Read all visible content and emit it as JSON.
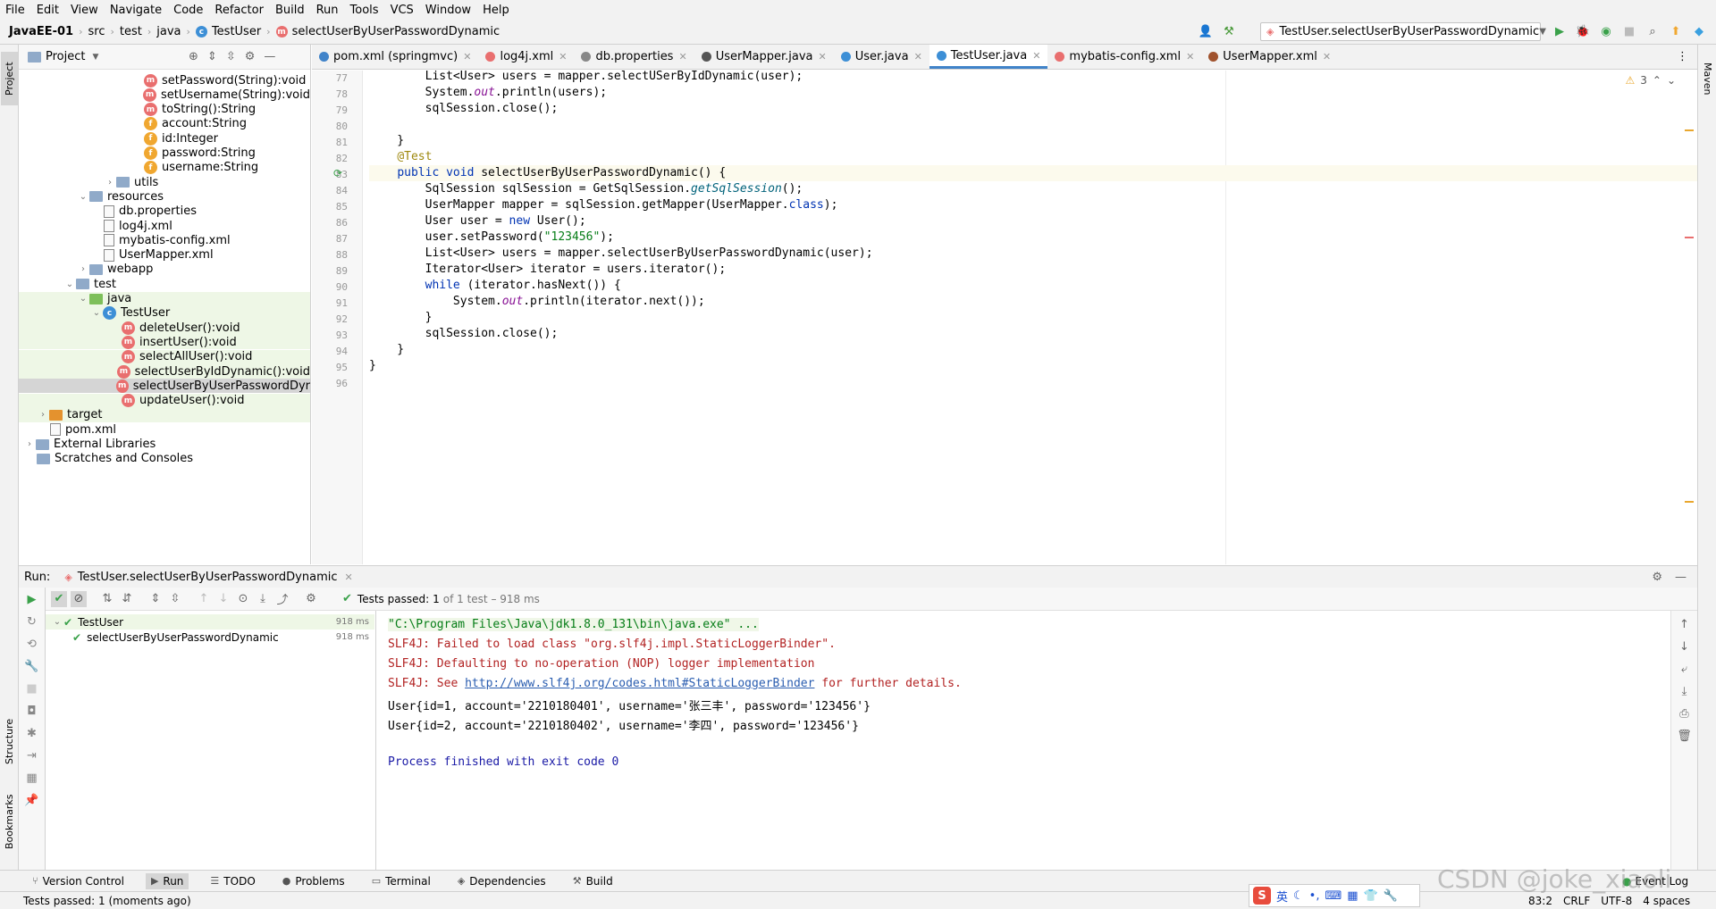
{
  "menu": [
    "File",
    "Edit",
    "View",
    "Navigate",
    "Code",
    "Refactor",
    "Build",
    "Run",
    "Tools",
    "VCS",
    "Window",
    "Help"
  ],
  "breadcrumb": [
    "JavaEE-01",
    "src",
    "test",
    "java",
    "TestUser",
    "selectUserByUserPasswordDynamic"
  ],
  "run_config": "TestUser.selectUserByUserPasswordDynamic",
  "project": {
    "title": "Project",
    "tree": [
      {
        "label": "setPassword(String):void",
        "icon": "m",
        "indent": 140
      },
      {
        "label": "setUsername(String):void",
        "icon": "m",
        "indent": 140
      },
      {
        "label": "toString():String",
        "icon": "m",
        "indent": 140
      },
      {
        "label": "account:String",
        "icon": "f",
        "indent": 140
      },
      {
        "label": "id:Integer",
        "icon": "f",
        "indent": 140
      },
      {
        "label": "password:String",
        "icon": "f",
        "indent": 140
      },
      {
        "label": "username:String",
        "icon": "f",
        "indent": 140
      },
      {
        "label": "utils",
        "icon": "folder",
        "indent": 95,
        "arrow": "›"
      },
      {
        "label": "resources",
        "icon": "folder",
        "indent": 65,
        "arrow": "⌄"
      },
      {
        "label": "db.properties",
        "icon": "file",
        "indent": 95
      },
      {
        "label": "log4j.xml",
        "icon": "file",
        "indent": 95
      },
      {
        "label": "mybatis-config.xml",
        "icon": "file",
        "indent": 95
      },
      {
        "label": "UserMapper.xml",
        "icon": "file",
        "indent": 95
      },
      {
        "label": "webapp",
        "icon": "folder",
        "indent": 65,
        "arrow": "›"
      },
      {
        "label": "test",
        "icon": "folder",
        "indent": 50,
        "arrow": "⌄"
      },
      {
        "label": "java",
        "icon": "folder-green",
        "indent": 65,
        "arrow": "⌄",
        "green": true
      },
      {
        "label": "TestUser",
        "icon": "c",
        "indent": 80,
        "arrow": "⌄",
        "green": true
      },
      {
        "label": "deleteUser():void",
        "icon": "m",
        "indent": 115,
        "green": true
      },
      {
        "label": "insertUser():void",
        "icon": "m",
        "indent": 115,
        "green": true
      },
      {
        "label": "selectAllUser():void",
        "icon": "m",
        "indent": 115,
        "green": true
      },
      {
        "label": "selectUserByIdDynamic():void",
        "icon": "m",
        "indent": 115,
        "green": true
      },
      {
        "label": "selectUserByUserPasswordDyr",
        "icon": "m",
        "indent": 115,
        "sel": true
      },
      {
        "label": "updateUser():void",
        "icon": "m",
        "indent": 115,
        "green": true
      },
      {
        "label": "target",
        "icon": "folder-orange",
        "indent": 20,
        "arrow": "›",
        "green": true
      },
      {
        "label": "pom.xml",
        "icon": "file",
        "indent": 35
      },
      {
        "label": "External Libraries",
        "icon": "lib",
        "indent": 5,
        "arrow": "›"
      },
      {
        "label": "Scratches and Consoles",
        "icon": "lib",
        "indent": 20
      }
    ]
  },
  "tabs": [
    {
      "label": "pom.xml (springmvc)",
      "color": "#4083c9"
    },
    {
      "label": "log4j.xml",
      "color": "#e96f6f"
    },
    {
      "label": "db.properties",
      "color": "#888888"
    },
    {
      "label": "UserMapper.java",
      "color": "#555555"
    },
    {
      "label": "User.java",
      "color": "#3d8fd6"
    },
    {
      "label": "TestUser.java",
      "color": "#3d8fd6",
      "active": true
    },
    {
      "label": "mybatis-config.xml",
      "color": "#e96f6f"
    },
    {
      "label": "UserMapper.xml",
      "color": "#a0522d"
    }
  ],
  "editor": {
    "warnings": "3",
    "lines": [
      {
        "n": "77",
        "html": "        List&lt;User&gt; users = mapper.selectUSerByIdDynamic(user);"
      },
      {
        "n": "78",
        "html": "        System.<span class='it'>out</span>.println(users);"
      },
      {
        "n": "79",
        "html": "        sqlSession.close();"
      },
      {
        "n": "80",
        "html": ""
      },
      {
        "n": "81",
        "html": "    }"
      },
      {
        "n": "82",
        "html": "    <span class='ann'>@Test</span>"
      },
      {
        "n": "83",
        "html": "    <span class='kw'>public void</span> selectUserByUserPasswordDynamic() {",
        "cur": true
      },
      {
        "n": "84",
        "html": "        SqlSession sqlSession = GetSqlSession.<span class='stat'>getSqlSession</span>();"
      },
      {
        "n": "85",
        "html": "        UserMapper mapper = sqlSession.getMapper(UserMapper.<span class='kw'>class</span>);"
      },
      {
        "n": "86",
        "html": "        User user = <span class='kw'>new</span> User();"
      },
      {
        "n": "87",
        "html": "        user.setPassword(<span class='str'>\"123456\"</span>);"
      },
      {
        "n": "88",
        "html": "        List&lt;User&gt; users = mapper.selectUserByUserPasswordDynamic(user);"
      },
      {
        "n": "89",
        "html": "        Iterator&lt;User&gt; iterator = users.iterator();"
      },
      {
        "n": "90",
        "html": "        <span class='kw'>while</span> (iterator.hasNext()) {"
      },
      {
        "n": "91",
        "html": "            System.<span class='it'>out</span>.println(iterator.next());"
      },
      {
        "n": "92",
        "html": "        }"
      },
      {
        "n": "93",
        "html": "        sqlSession.close();"
      },
      {
        "n": "94",
        "html": "    }"
      },
      {
        "n": "95",
        "html": "}"
      },
      {
        "n": "96",
        "html": ""
      }
    ]
  },
  "run": {
    "label": "Run:",
    "config": "TestUser.selectUserByUserPasswordDynamic",
    "status": "Tests passed:",
    "status_count": "1",
    "status_detail": "of 1 test – 918 ms",
    "tree": [
      {
        "label": "TestUser",
        "time": "918 ms"
      },
      {
        "label": "selectUserByUserPasswordDynamic",
        "time": "918 ms"
      }
    ],
    "console": [
      {
        "text": "\"C:\\Program Files\\Java\\jdk1.8.0_131\\bin\\java.exe\" ...",
        "color": "#067d17",
        "bg": "#f0f7e8"
      },
      {
        "text": "SLF4J: Failed to load class \"org.slf4j.impl.StaticLoggerBinder\".",
        "color": "#b22222"
      },
      {
        "text": "SLF4J: Defaulting to no-operation (NOP) logger implementation",
        "color": "#b22222"
      },
      {
        "pre": "SLF4J: See ",
        "link": "http://www.slf4j.org/codes.html#StaticLoggerBinder",
        "post": " for further details.",
        "color": "#b22222"
      },
      {
        "text": "User{id=1, account='2210180401', username='张三丰', password='123456'}",
        "color": "#000000"
      },
      {
        "text": "User{id=2, account='2210180402', username='李四', password='123456'}",
        "color": "#000000"
      },
      {
        "text": "",
        "color": "#000000"
      },
      {
        "text": "Process finished with exit code 0",
        "color": "#1a1aa6"
      }
    ]
  },
  "bottom_tabs": [
    "Version Control",
    "Run",
    "TODO",
    "Problems",
    "Terminal",
    "Dependencies",
    "Build"
  ],
  "status": {
    "message": "Tests passed: 1 (moments ago)",
    "position": "83:2",
    "line_sep": "CRLF",
    "encoding": "UTF-8",
    "indent": "4 spaces",
    "event_log": "Event Log",
    "watermark": "CSDN @joke_xiaoli"
  },
  "side_tabs": {
    "project": "Project",
    "structure": "Structure",
    "bookmarks": "Bookmarks",
    "maven": "Maven"
  }
}
